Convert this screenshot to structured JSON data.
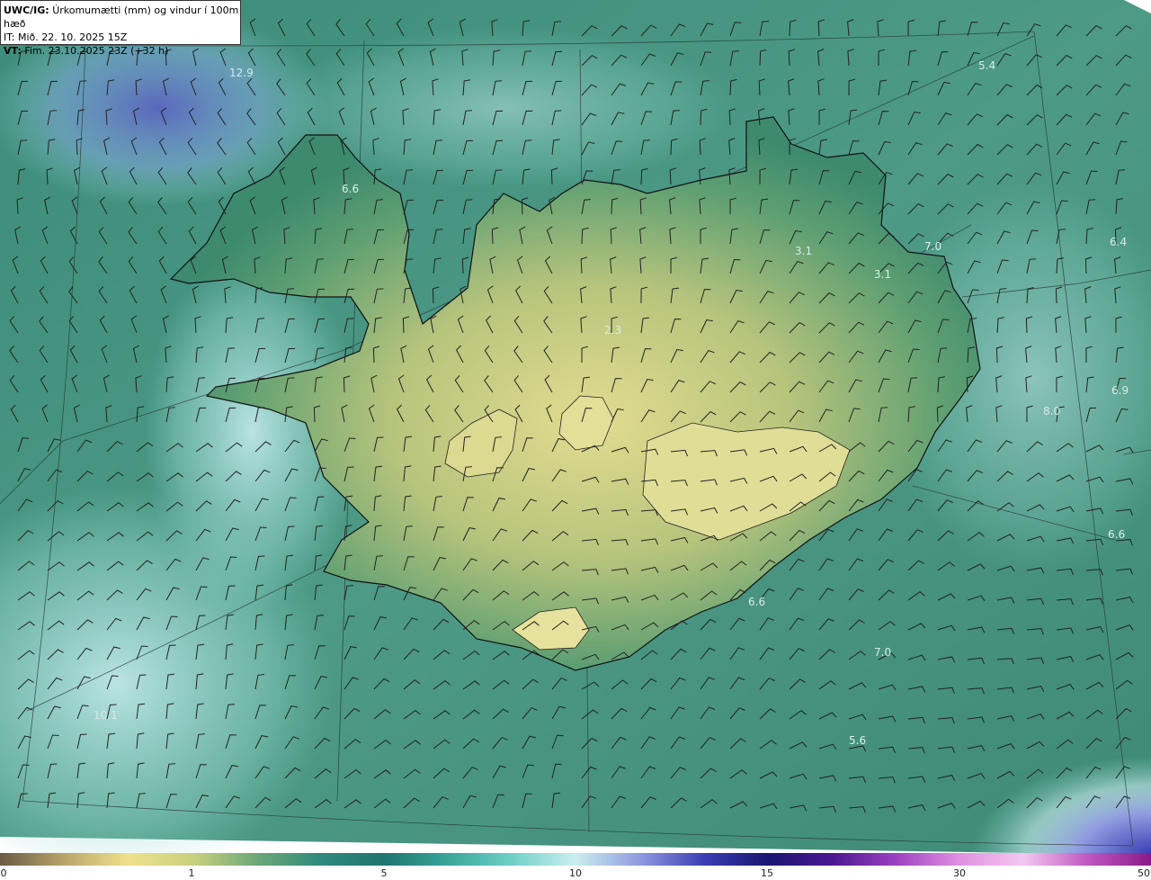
{
  "header": {
    "line1_bold": "UWC/IG:",
    "line1_text": "Úrkomumætti (mm) og vindur í 100m hæð",
    "line2_text": "IT: Mið. 22. 10. 2025 15Z",
    "line3_bold": "VT:",
    "line3_text": "Fim. 23.10.2025 23Z (+32 h)"
  },
  "map_labels": [
    "12.9",
    "5.4",
    "6.6",
    "7.0",
    "6.4",
    "3.1",
    "3.1",
    "2.3",
    "6.9",
    "8.0",
    "6.6",
    "6.6",
    "7.0",
    "10.1",
    "5.6"
  ],
  "legend": {
    "ticks": [
      "0",
      "1",
      "5",
      "10",
      "15",
      "30",
      "50"
    ],
    "colors": [
      "#6b5a44",
      "#b8a56a",
      "#f0e08c",
      "#c9d27e",
      "#6fa878",
      "#2f8a7c",
      "#1f7570",
      "#3aa59a",
      "#6fd0c8",
      "#cbeef0",
      "#8f9be0",
      "#3a3fb5",
      "#1a1670",
      "#4a1890",
      "#9a40c0",
      "#e090e0",
      "#f4c8f0",
      "#c058c0",
      "#8a1a88"
    ]
  },
  "colors": {
    "sea": "#4f9c8c",
    "sea_light": "#8fd3cc",
    "sea_blue": "#6a78c8",
    "land_low": "#3f8c6c",
    "land_high": "#d9d58a",
    "coast": "#111111"
  }
}
